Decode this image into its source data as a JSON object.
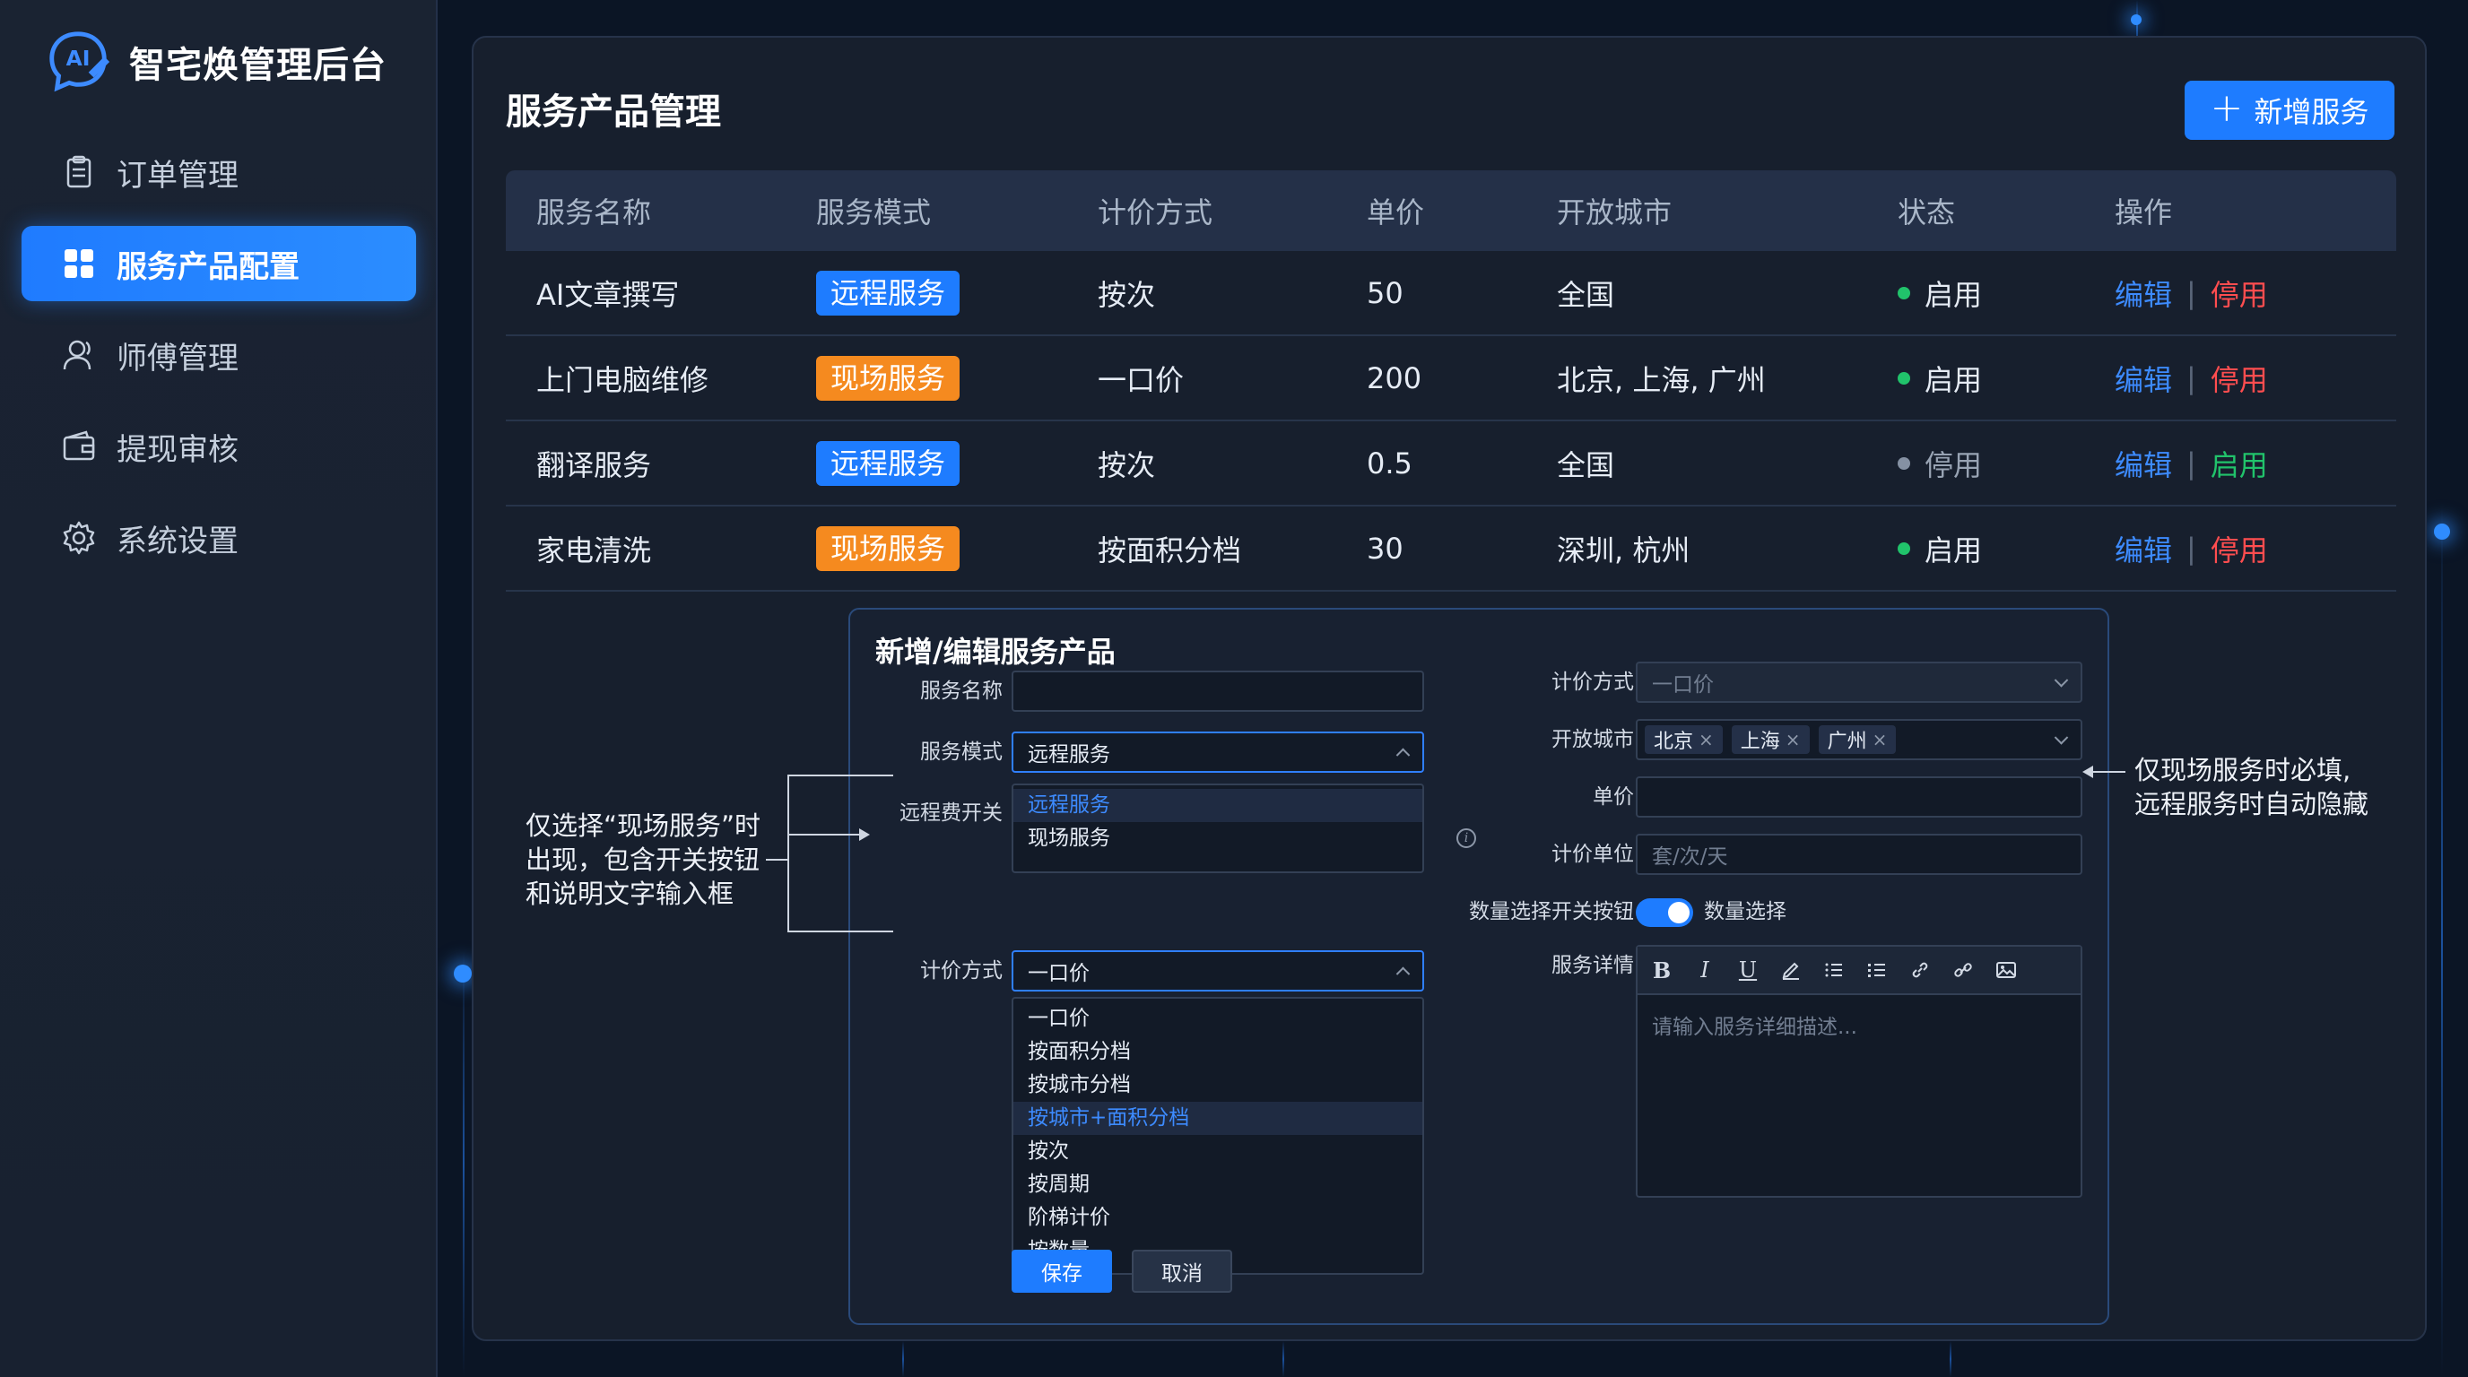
{
  "app": {
    "title": "智宅焕管理后台",
    "logo_text": "AI"
  },
  "sidebar": {
    "items": [
      {
        "label": "订单管理",
        "icon": "clipboard-icon",
        "active": false
      },
      {
        "label": "服务产品配置",
        "icon": "grid-icon",
        "active": true
      },
      {
        "label": "师傅管理",
        "icon": "user-icon",
        "active": false
      },
      {
        "label": "提现审核",
        "icon": "wallet-icon",
        "active": false
      },
      {
        "label": "系统设置",
        "icon": "gear-icon",
        "active": false
      }
    ]
  },
  "page": {
    "title": "服务产品管理",
    "add_button": "新增服务"
  },
  "table": {
    "columns": [
      "服务名称",
      "服务模式",
      "计价方式",
      "单价",
      "开放城市",
      "状态",
      "操作"
    ],
    "rows": [
      {
        "name": "AI文章撰写",
        "mode": "远程服务",
        "mode_type": "remote",
        "pricing": "按次",
        "price": "50",
        "cities": "全国",
        "status": "启用",
        "status_type": "on",
        "edit": "编辑",
        "toggle": "停用"
      },
      {
        "name": "上门电脑维修",
        "mode": "现场服务",
        "mode_type": "onsite",
        "pricing": "一口价",
        "price": "200",
        "cities": "北京, 上海, 广州",
        "status": "启用",
        "status_type": "on",
        "edit": "编辑",
        "toggle": "停用"
      },
      {
        "name": "翻译服务",
        "mode": "远程服务",
        "mode_type": "remote",
        "pricing": "按次",
        "price": "0.5",
        "cities": "全国",
        "status": "停用",
        "status_type": "off",
        "edit": "编辑",
        "toggle": "启用"
      },
      {
        "name": "家电清洗",
        "mode": "现场服务",
        "mode_type": "onsite",
        "pricing": "按面积分档",
        "price": "30",
        "cities": "深圳, 杭州",
        "status": "启用",
        "status_type": "on",
        "edit": "编辑",
        "toggle": "停用"
      }
    ]
  },
  "form": {
    "title": "新增/编辑服务产品",
    "name_label": "服务名称",
    "name_value": "",
    "mode_label": "服务模式",
    "mode_value": "远程服务",
    "mode_options": [
      "远程服务",
      "现场服务"
    ],
    "remote_fee_label": "远程费开关",
    "pricing_label_left": "计价方式",
    "pricing_value_left": "一口价",
    "pricing_options": [
      "一口价",
      "按面积分档",
      "按城市分档",
      "按城市+面积分档",
      "按次",
      "按周期",
      "阶梯计价",
      "按数量"
    ],
    "pricing_options_selected_index": 3,
    "pricing_label_right": "计价方式",
    "pricing_placeholder_right": "一口价",
    "cities_label": "开放城市",
    "cities_chips": [
      "北京",
      "上海",
      "广州"
    ],
    "price_label": "单价",
    "unit_label": "计价单位",
    "unit_placeholder": "套/次/天",
    "qty_toggle_label": "数量选择开关按钮",
    "qty_toggle_text": "数量选择",
    "qty_toggle_on": true,
    "detail_label": "服务详情",
    "detail_placeholder": "请输入服务详细描述...",
    "save": "保存",
    "cancel": "取消"
  },
  "annotations": {
    "left": [
      "仅选择“现场服务”时",
      "出现，包含开关按钮",
      "和说明文字输入框"
    ],
    "right": [
      "仅现场服务时必填,",
      "远程服务时自动隐藏"
    ]
  },
  "colors": {
    "accent": "#1e7cff",
    "onsite": "#f58a1f",
    "success": "#21c36b",
    "danger": "#ff4d4f",
    "background": "#0b1525",
    "panel": "#171f2d"
  }
}
